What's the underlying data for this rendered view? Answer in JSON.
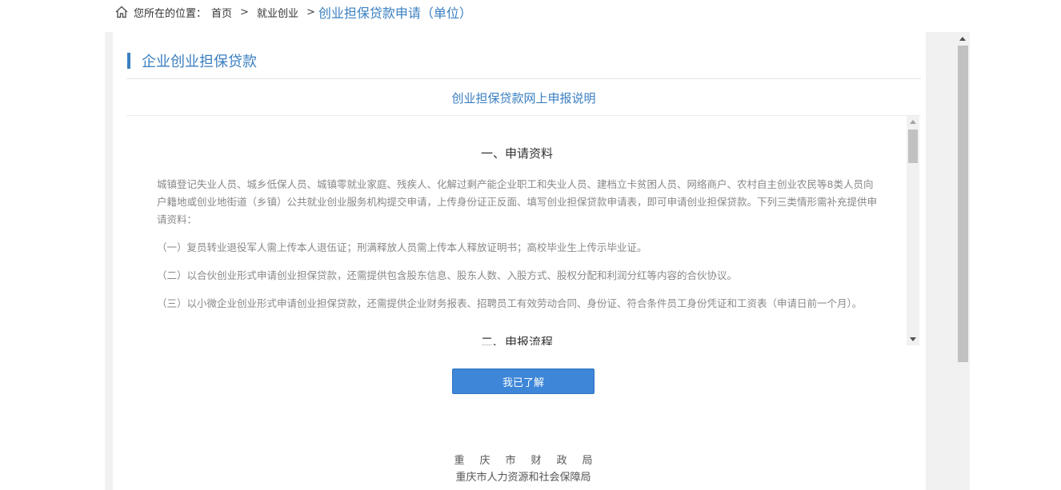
{
  "breadcrumb": {
    "prefix": "您所在的位置：",
    "home": "首页",
    "separator": ">",
    "section": "就业创业",
    "current": "创业担保贷款申请（单位）"
  },
  "panel": {
    "title": "企业创业担保贷款",
    "subtitle": "创业担保贷款网上申报说明"
  },
  "content": {
    "heading1": "一、申请资料",
    "intro": "城镇登记失业人员、城乡低保人员、城镇零就业家庭、残疾人、化解过剩产能企业职工和失业人员、建档立卡贫困人员、网络商户、农村自主创业农民等8类人员向户籍地或创业地街道（乡镇）公共就业创业服务机构提交申请，上传身份证正反面、填写创业担保贷款申请表，即可申请创业担保贷款。下列三类情形需补充提供申请资料：",
    "items": [
      "（一）复员转业退役军人需上传本人退伍证；刑满释放人员需上传本人释放证明书；高校毕业生上传示毕业证。",
      "（二）以合伙创业形式申请创业担保贷款，还需提供包含股东信息、股东人数、入股方式、股权分配和利润分红等内容的合伙协议。",
      "（三）以小微企业创业形式申请创业担保贷款，还需提供企业财务报表、招聘员工有效劳动合同、身份证、符合条件员工身份凭证和工资表（申请日前一个月）。"
    ],
    "heading2": "二、申报流程"
  },
  "button": {
    "acknowledge": "我已了解"
  },
  "footer": {
    "line1": "重庆市财政局",
    "line2": "重庆市人力资源和社会保障局"
  },
  "colors": {
    "accent": "#3a7fc1",
    "button": "#3d86d8"
  }
}
